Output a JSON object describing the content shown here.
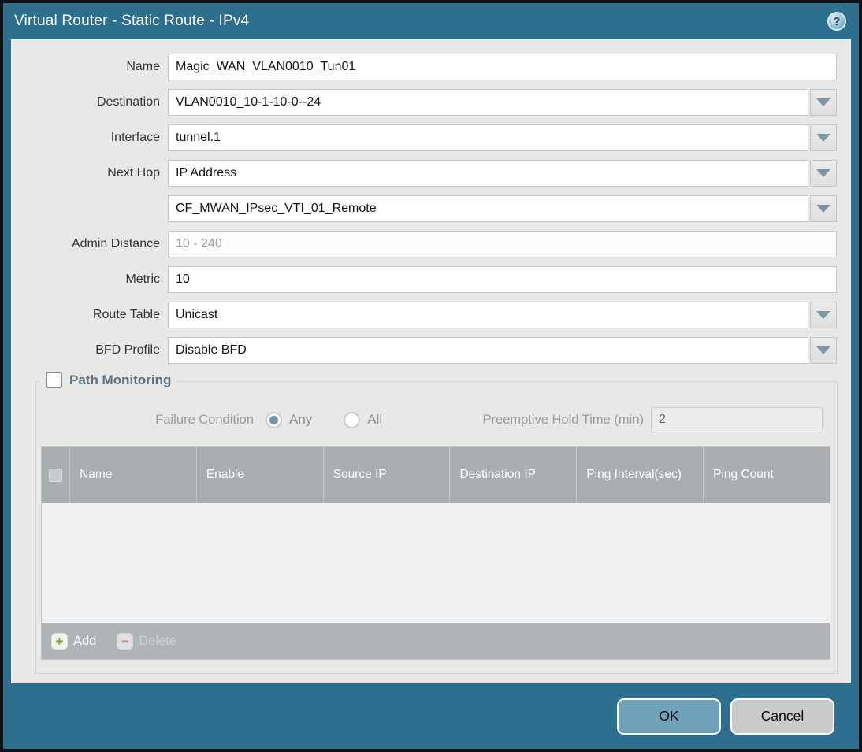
{
  "window": {
    "title": "Virtual Router - Static Route - IPv4",
    "help_glyph": "?"
  },
  "form": {
    "name": {
      "label": "Name",
      "value": "Magic_WAN_VLAN0010_Tun01"
    },
    "destination": {
      "label": "Destination",
      "value": "VLAN0010_10-1-10-0--24"
    },
    "interface": {
      "label": "Interface",
      "value": "tunnel.1"
    },
    "next_hop": {
      "label": "Next Hop",
      "value": "IP Address"
    },
    "next_hop_address": {
      "value": "CF_MWAN_IPsec_VTI_01_Remote"
    },
    "admin_distance": {
      "label": "Admin Distance",
      "placeholder": "10 - 240",
      "value": ""
    },
    "metric": {
      "label": "Metric",
      "value": "10"
    },
    "route_table": {
      "label": "Route Table",
      "value": "Unicast"
    },
    "bfd_profile": {
      "label": "BFD Profile",
      "value": "Disable BFD"
    }
  },
  "path_monitoring": {
    "title": "Path Monitoring",
    "enabled": false,
    "failure_condition": {
      "label": "Failure Condition",
      "options": [
        "Any",
        "All"
      ],
      "selected": "Any"
    },
    "preemptive_hold_time": {
      "label": "Preemptive Hold Time (min)",
      "value": "2"
    },
    "table": {
      "columns": [
        "Name",
        "Enable",
        "Source IP",
        "Destination IP",
        "Ping Interval(sec)",
        "Ping Count"
      ],
      "rows": []
    },
    "add_label": "Add",
    "delete_label": "Delete"
  },
  "footer": {
    "ok_label": "OK",
    "cancel_label": "Cancel"
  }
}
